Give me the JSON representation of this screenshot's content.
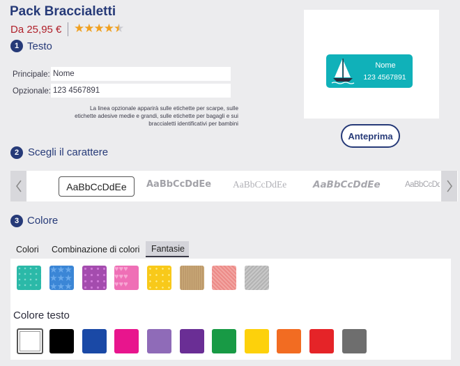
{
  "product": {
    "title": "Pack Braccialetti",
    "price": "Da 25,95 €",
    "rating": "4.5 of 5"
  },
  "steps": [
    {
      "number": "1",
      "label": "Testo"
    },
    {
      "number": "2",
      "label": "Scegli il carattere"
    },
    {
      "number": "3",
      "label": "Colore"
    }
  ],
  "text_fields": {
    "main_label": "Principale:",
    "main_value": "Nome",
    "optional_label": "Opzionale:",
    "optional_value": "123 4567891",
    "note": "La linea opzionale apparirà sulle etichette per scarpe, sulle etichette adesive medie e grandi, sulle etichette per bagagli e sui braccialetti identificativi per bambini"
  },
  "preview": {
    "name": "Nome",
    "number": "123 4567891",
    "button_label": "Anteprima",
    "tag_color": "#10b1b9"
  },
  "fonts": {
    "samples": [
      "AaBbCcDdEe",
      "AaBbCcDdEe",
      "AaBbCcDdEe",
      "AaBbCcDdEe",
      "AaBbCcDd"
    ],
    "selected_index": 0
  },
  "color_tabs": [
    "Colori",
    "Combinazione di colori",
    "Fantasie"
  ],
  "active_tab": "Fantasie",
  "patterns": [
    {
      "name": "teal-dots",
      "color": "#2bb9a8"
    },
    {
      "name": "blue-stars",
      "color": "#3b86d6"
    },
    {
      "name": "purple-floral",
      "color": "#a44cae"
    },
    {
      "name": "pink-hearts",
      "color": "#ef6fb6"
    },
    {
      "name": "yellow-dots",
      "color": "#f8c91a"
    },
    {
      "name": "kraft-lines",
      "color": "#c6a574"
    },
    {
      "name": "coral-texture",
      "color": "#ec8a87"
    },
    {
      "name": "grey-texture",
      "color": "#b3b3b3"
    }
  ],
  "text_color_label": "Colore testo",
  "text_colors": [
    "#ffffff",
    "#000000",
    "#1a49a6",
    "#e8158d",
    "#8f6bb8",
    "#6a2e95",
    "#189a45",
    "#fdd10b",
    "#f26c22",
    "#e52428",
    "#6e6e6e"
  ]
}
